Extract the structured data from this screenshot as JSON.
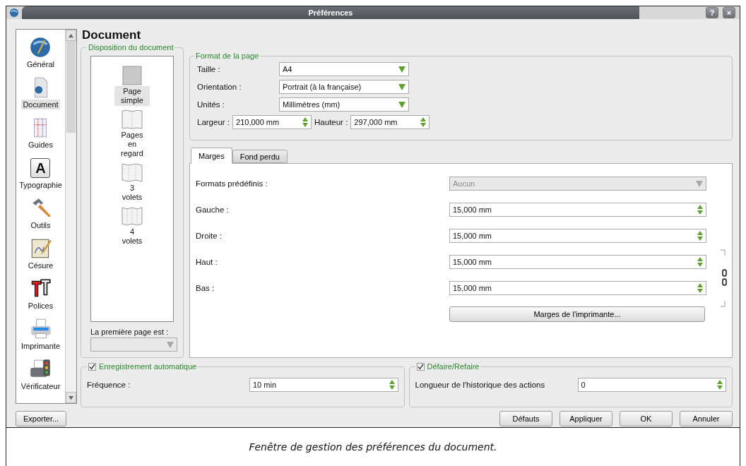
{
  "window": {
    "title": "Préférences",
    "buttons": [
      "?",
      "×"
    ]
  },
  "sidebar": {
    "items": [
      {
        "label": "Général",
        "selected": false
      },
      {
        "label": "Document",
        "selected": true
      },
      {
        "label": "Guides",
        "selected": false
      },
      {
        "label": "Typographie",
        "selected": false,
        "glyph": "A"
      },
      {
        "label": "Outils",
        "selected": false
      },
      {
        "label": "Césure",
        "selected": false
      },
      {
        "label": "Polices",
        "selected": false
      },
      {
        "label": "Imprimante",
        "selected": false
      },
      {
        "label": "Vérificateur",
        "selected": false
      }
    ]
  },
  "heading": "Document",
  "layout_group": {
    "title": "Disposition du document",
    "options": [
      {
        "label": "Page simple",
        "selected": true
      },
      {
        "label": "Pages en regard",
        "selected": false
      },
      {
        "label": "3 volets",
        "selected": false
      },
      {
        "label": "4 volets",
        "selected": false
      }
    ],
    "first_page_label": "La première page est :",
    "first_page_disabled": true
  },
  "page_format": {
    "title": "Format de la page",
    "rows": [
      {
        "label": "Taille :",
        "value": "A4",
        "kind": "select"
      },
      {
        "label": "Orientation :",
        "value": "Portrait (à la française)",
        "kind": "select"
      },
      {
        "label": "Unités :",
        "value": "Millimètres (mm)",
        "kind": "select"
      }
    ],
    "width": {
      "label": "Largeur :",
      "value": "210,000 mm"
    },
    "height": {
      "label": "Hauteur :",
      "value": "297,000 mm"
    }
  },
  "tabs": [
    {
      "label": "Marges",
      "selected": true
    },
    {
      "label": "Fond perdu",
      "selected": false
    }
  ],
  "margins": {
    "rows": [
      {
        "label": "Formats prédéfinis :",
        "value": "Aucun",
        "kind": "select",
        "disabled": true
      },
      {
        "label": "Gauche :",
        "value": "15,000 mm",
        "kind": "spin",
        "disabled": false
      },
      {
        "label": "Droite :",
        "value": "15,000 mm",
        "kind": "spin",
        "disabled": false
      },
      {
        "label": "Haut :",
        "value": "15,000 mm",
        "kind": "spin",
        "disabled": false
      },
      {
        "label": "Bas :",
        "value": "15,000 mm",
        "kind": "spin",
        "disabled": false
      }
    ],
    "printer_button": "Marges de l'imprimante..."
  },
  "autosave": {
    "title": "Enregistrement automatique",
    "checked": true,
    "label": "Fréquence :",
    "value": "10 min"
  },
  "undo": {
    "title": "Défaire/Refaire",
    "checked": true,
    "label": "Longueur de l'historique des actions",
    "value": "0"
  },
  "buttons": {
    "export": "Exporter...",
    "actions": [
      "Défauts",
      "Appliquer",
      "OK",
      "Annuler"
    ]
  },
  "caption": "Fenêtre de gestion des préférences du document."
}
